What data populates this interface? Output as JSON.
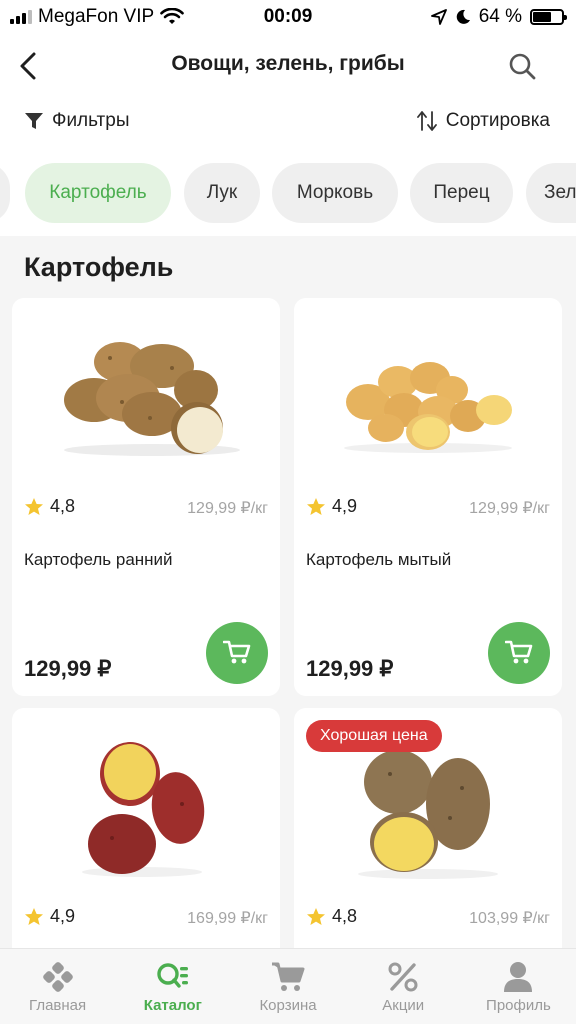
{
  "status_bar": {
    "carrier": "MegaFon VIP",
    "time": "00:09",
    "battery": "64 %",
    "battery_level": 0.64
  },
  "header": {
    "title": "Овощи, зелень, грибы",
    "back_icon": "chevron-left-icon",
    "search_icon": "search-icon"
  },
  "toolbar": {
    "filters_label": "Фильтры",
    "sort_label": "Сортировка"
  },
  "chips": [
    {
      "label": "Картофель",
      "active": true
    },
    {
      "label": "Лук",
      "active": false
    },
    {
      "label": "Морковь",
      "active": false
    },
    {
      "label": "Перец",
      "active": false
    },
    {
      "label": "Зел",
      "active": false
    }
  ],
  "section": {
    "title": "Картофель"
  },
  "products": [
    {
      "name": "Картофель ранний",
      "rating": "4,8",
      "unit_price": "129,99 ₽/кг",
      "price": "129,99 ₽"
    },
    {
      "name": "Картофель мытый",
      "rating": "4,9",
      "unit_price": "129,99 ₽/кг",
      "price": "129,99 ₽"
    },
    {
      "name": "",
      "rating": "4,9",
      "unit_price": "169,99 ₽/кг",
      "price": ""
    },
    {
      "name": "",
      "rating": "4,8",
      "unit_price": "103,99 ₽/кг",
      "price": "",
      "badge": "Хорошая цена"
    }
  ],
  "tabbar": [
    {
      "label": "Главная",
      "icon": "home-icon",
      "active": false
    },
    {
      "label": "Каталог",
      "icon": "catalog-icon",
      "active": true
    },
    {
      "label": "Корзина",
      "icon": "cart-icon",
      "active": false
    },
    {
      "label": "Акции",
      "icon": "percent-icon",
      "active": false
    },
    {
      "label": "Профиль",
      "icon": "profile-icon",
      "active": false
    }
  ],
  "colors": {
    "accent": "#5cb85c",
    "accent_text": "#4bae4f",
    "badge": "#d83a3a",
    "background": "#f5f5f5"
  }
}
